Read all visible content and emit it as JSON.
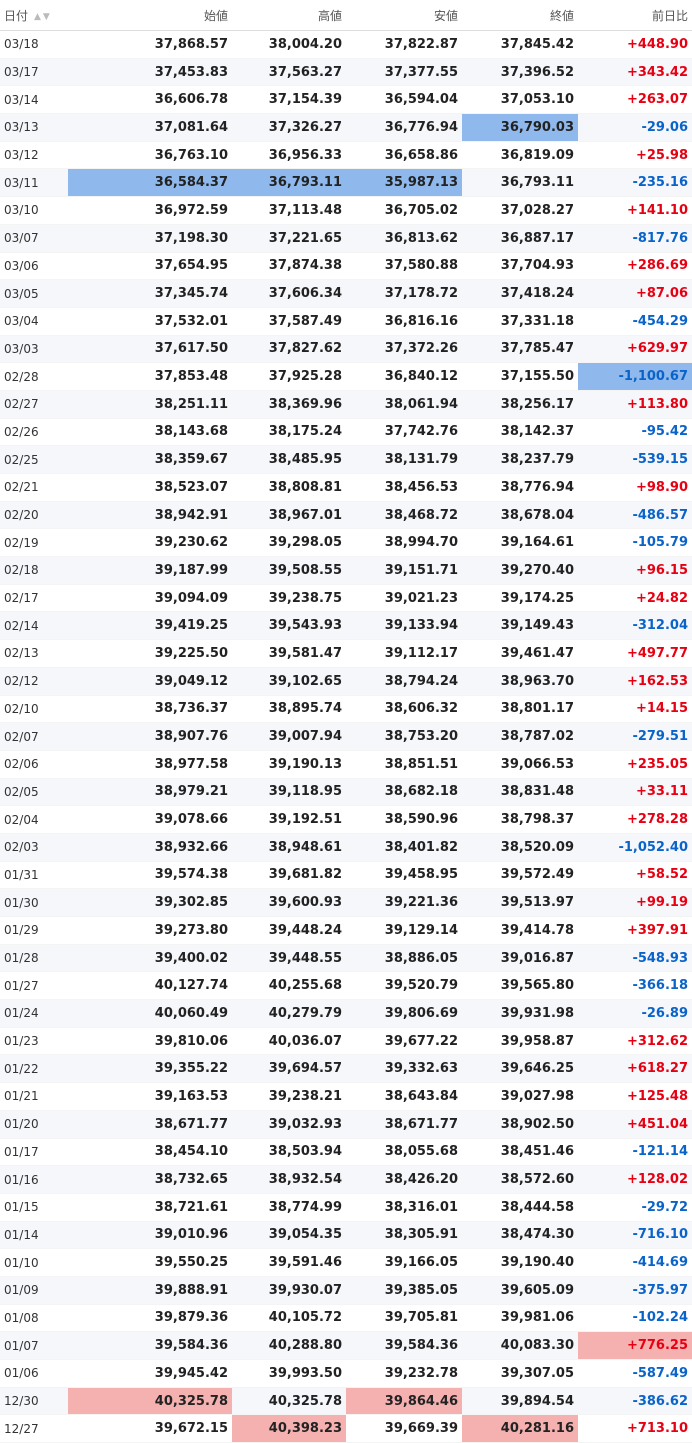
{
  "columns": [
    "日付",
    "始値",
    "高値",
    "安値",
    "終値",
    "前日比"
  ],
  "rows": [
    {
      "date": "03/18",
      "open": "37,868.57",
      "high": "38,004.20",
      "low": "37,822.87",
      "close": "37,845.42",
      "change": "+448.90",
      "hl": []
    },
    {
      "date": "03/17",
      "open": "37,453.83",
      "high": "37,563.27",
      "low": "37,377.55",
      "close": "37,396.52",
      "change": "+343.42",
      "hl": []
    },
    {
      "date": "03/14",
      "open": "36,606.78",
      "high": "37,154.39",
      "low": "36,594.04",
      "close": "37,053.10",
      "change": "+263.07",
      "hl": []
    },
    {
      "date": "03/13",
      "open": "37,081.64",
      "high": "37,326.27",
      "low": "36,776.94",
      "close": "36,790.03",
      "change": "-29.06",
      "hl": [
        {
          "col": "close",
          "color": "blue"
        }
      ]
    },
    {
      "date": "03/12",
      "open": "36,763.10",
      "high": "36,956.33",
      "low": "36,658.86",
      "close": "36,819.09",
      "change": "+25.98",
      "hl": []
    },
    {
      "date": "03/11",
      "open": "36,584.37",
      "high": "36,793.11",
      "low": "35,987.13",
      "close": "36,793.11",
      "change": "-235.16",
      "hl": [
        {
          "col": "open",
          "color": "blue"
        },
        {
          "col": "high",
          "color": "blue"
        },
        {
          "col": "low",
          "color": "blue"
        }
      ]
    },
    {
      "date": "03/10",
      "open": "36,972.59",
      "high": "37,113.48",
      "low": "36,705.02",
      "close": "37,028.27",
      "change": "+141.10",
      "hl": []
    },
    {
      "date": "03/07",
      "open": "37,198.30",
      "high": "37,221.65",
      "low": "36,813.62",
      "close": "36,887.17",
      "change": "-817.76",
      "hl": []
    },
    {
      "date": "03/06",
      "open": "37,654.95",
      "high": "37,874.38",
      "low": "37,580.88",
      "close": "37,704.93",
      "change": "+286.69",
      "hl": []
    },
    {
      "date": "03/05",
      "open": "37,345.74",
      "high": "37,606.34",
      "low": "37,178.72",
      "close": "37,418.24",
      "change": "+87.06",
      "hl": []
    },
    {
      "date": "03/04",
      "open": "37,532.01",
      "high": "37,587.49",
      "low": "36,816.16",
      "close": "37,331.18",
      "change": "-454.29",
      "hl": []
    },
    {
      "date": "03/03",
      "open": "37,617.50",
      "high": "37,827.62",
      "low": "37,372.26",
      "close": "37,785.47",
      "change": "+629.97",
      "hl": []
    },
    {
      "date": "02/28",
      "open": "37,853.48",
      "high": "37,925.28",
      "low": "36,840.12",
      "close": "37,155.50",
      "change": "-1,100.67",
      "hl": [
        {
          "col": "change",
          "color": "blue"
        }
      ]
    },
    {
      "date": "02/27",
      "open": "38,251.11",
      "high": "38,369.96",
      "low": "38,061.94",
      "close": "38,256.17",
      "change": "+113.80",
      "hl": []
    },
    {
      "date": "02/26",
      "open": "38,143.68",
      "high": "38,175.24",
      "low": "37,742.76",
      "close": "38,142.37",
      "change": "-95.42",
      "hl": []
    },
    {
      "date": "02/25",
      "open": "38,359.67",
      "high": "38,485.95",
      "low": "38,131.79",
      "close": "38,237.79",
      "change": "-539.15",
      "hl": []
    },
    {
      "date": "02/21",
      "open": "38,523.07",
      "high": "38,808.81",
      "low": "38,456.53",
      "close": "38,776.94",
      "change": "+98.90",
      "hl": []
    },
    {
      "date": "02/20",
      "open": "38,942.91",
      "high": "38,967.01",
      "low": "38,468.72",
      "close": "38,678.04",
      "change": "-486.57",
      "hl": []
    },
    {
      "date": "02/19",
      "open": "39,230.62",
      "high": "39,298.05",
      "low": "38,994.70",
      "close": "39,164.61",
      "change": "-105.79",
      "hl": []
    },
    {
      "date": "02/18",
      "open": "39,187.99",
      "high": "39,508.55",
      "low": "39,151.71",
      "close": "39,270.40",
      "change": "+96.15",
      "hl": []
    },
    {
      "date": "02/17",
      "open": "39,094.09",
      "high": "39,238.75",
      "low": "39,021.23",
      "close": "39,174.25",
      "change": "+24.82",
      "hl": []
    },
    {
      "date": "02/14",
      "open": "39,419.25",
      "high": "39,543.93",
      "low": "39,133.94",
      "close": "39,149.43",
      "change": "-312.04",
      "hl": []
    },
    {
      "date": "02/13",
      "open": "39,225.50",
      "high": "39,581.47",
      "low": "39,112.17",
      "close": "39,461.47",
      "change": "+497.77",
      "hl": []
    },
    {
      "date": "02/12",
      "open": "39,049.12",
      "high": "39,102.65",
      "low": "38,794.24",
      "close": "38,963.70",
      "change": "+162.53",
      "hl": []
    },
    {
      "date": "02/10",
      "open": "38,736.37",
      "high": "38,895.74",
      "low": "38,606.32",
      "close": "38,801.17",
      "change": "+14.15",
      "hl": []
    },
    {
      "date": "02/07",
      "open": "38,907.76",
      "high": "39,007.94",
      "low": "38,753.20",
      "close": "38,787.02",
      "change": "-279.51",
      "hl": []
    },
    {
      "date": "02/06",
      "open": "38,977.58",
      "high": "39,190.13",
      "low": "38,851.51",
      "close": "39,066.53",
      "change": "+235.05",
      "hl": []
    },
    {
      "date": "02/05",
      "open": "38,979.21",
      "high": "39,118.95",
      "low": "38,682.18",
      "close": "38,831.48",
      "change": "+33.11",
      "hl": []
    },
    {
      "date": "02/04",
      "open": "39,078.66",
      "high": "39,192.51",
      "low": "38,590.96",
      "close": "38,798.37",
      "change": "+278.28",
      "hl": []
    },
    {
      "date": "02/03",
      "open": "38,932.66",
      "high": "38,948.61",
      "low": "38,401.82",
      "close": "38,520.09",
      "change": "-1,052.40",
      "hl": []
    },
    {
      "date": "01/31",
      "open": "39,574.38",
      "high": "39,681.82",
      "low": "39,458.95",
      "close": "39,572.49",
      "change": "+58.52",
      "hl": []
    },
    {
      "date": "01/30",
      "open": "39,302.85",
      "high": "39,600.93",
      "low": "39,221.36",
      "close": "39,513.97",
      "change": "+99.19",
      "hl": []
    },
    {
      "date": "01/29",
      "open": "39,273.80",
      "high": "39,448.24",
      "low": "39,129.14",
      "close": "39,414.78",
      "change": "+397.91",
      "hl": []
    },
    {
      "date": "01/28",
      "open": "39,400.02",
      "high": "39,448.55",
      "low": "38,886.05",
      "close": "39,016.87",
      "change": "-548.93",
      "hl": []
    },
    {
      "date": "01/27",
      "open": "40,127.74",
      "high": "40,255.68",
      "low": "39,520.79",
      "close": "39,565.80",
      "change": "-366.18",
      "hl": []
    },
    {
      "date": "01/24",
      "open": "40,060.49",
      "high": "40,279.79",
      "low": "39,806.69",
      "close": "39,931.98",
      "change": "-26.89",
      "hl": []
    },
    {
      "date": "01/23",
      "open": "39,810.06",
      "high": "40,036.07",
      "low": "39,677.22",
      "close": "39,958.87",
      "change": "+312.62",
      "hl": []
    },
    {
      "date": "01/22",
      "open": "39,355.22",
      "high": "39,694.57",
      "low": "39,332.63",
      "close": "39,646.25",
      "change": "+618.27",
      "hl": []
    },
    {
      "date": "01/21",
      "open": "39,163.53",
      "high": "39,238.21",
      "low": "38,643.84",
      "close": "39,027.98",
      "change": "+125.48",
      "hl": []
    },
    {
      "date": "01/20",
      "open": "38,671.77",
      "high": "39,032.93",
      "low": "38,671.77",
      "close": "38,902.50",
      "change": "+451.04",
      "hl": []
    },
    {
      "date": "01/17",
      "open": "38,454.10",
      "high": "38,503.94",
      "low": "38,055.68",
      "close": "38,451.46",
      "change": "-121.14",
      "hl": []
    },
    {
      "date": "01/16",
      "open": "38,732.65",
      "high": "38,932.54",
      "low": "38,426.20",
      "close": "38,572.60",
      "change": "+128.02",
      "hl": []
    },
    {
      "date": "01/15",
      "open": "38,721.61",
      "high": "38,774.99",
      "low": "38,316.01",
      "close": "38,444.58",
      "change": "-29.72",
      "hl": []
    },
    {
      "date": "01/14",
      "open": "39,010.96",
      "high": "39,054.35",
      "low": "38,305.91",
      "close": "38,474.30",
      "change": "-716.10",
      "hl": []
    },
    {
      "date": "01/10",
      "open": "39,550.25",
      "high": "39,591.46",
      "low": "39,166.05",
      "close": "39,190.40",
      "change": "-414.69",
      "hl": []
    },
    {
      "date": "01/09",
      "open": "39,888.91",
      "high": "39,930.07",
      "low": "39,385.05",
      "close": "39,605.09",
      "change": "-375.97",
      "hl": []
    },
    {
      "date": "01/08",
      "open": "39,879.36",
      "high": "40,105.72",
      "low": "39,705.81",
      "close": "39,981.06",
      "change": "-102.24",
      "hl": []
    },
    {
      "date": "01/07",
      "open": "39,584.36",
      "high": "40,288.80",
      "low": "39,584.36",
      "close": "40,083.30",
      "change": "+776.25",
      "hl": [
        {
          "col": "change",
          "color": "red"
        }
      ]
    },
    {
      "date": "01/06",
      "open": "39,945.42",
      "high": "39,993.50",
      "low": "39,232.78",
      "close": "39,307.05",
      "change": "-587.49",
      "hl": []
    },
    {
      "date": "12/30",
      "open": "40,325.78",
      "high": "40,325.78",
      "low": "39,864.46",
      "close": "39,894.54",
      "change": "-386.62",
      "hl": [
        {
          "col": "open",
          "color": "red"
        },
        {
          "col": "low",
          "color": "red"
        }
      ]
    },
    {
      "date": "12/27",
      "open": "39,672.15",
      "high": "40,398.23",
      "low": "39,669.39",
      "close": "40,281.16",
      "change": "+713.10",
      "hl": [
        {
          "col": "high",
          "color": "red"
        },
        {
          "col": "close",
          "color": "red"
        }
      ]
    }
  ]
}
